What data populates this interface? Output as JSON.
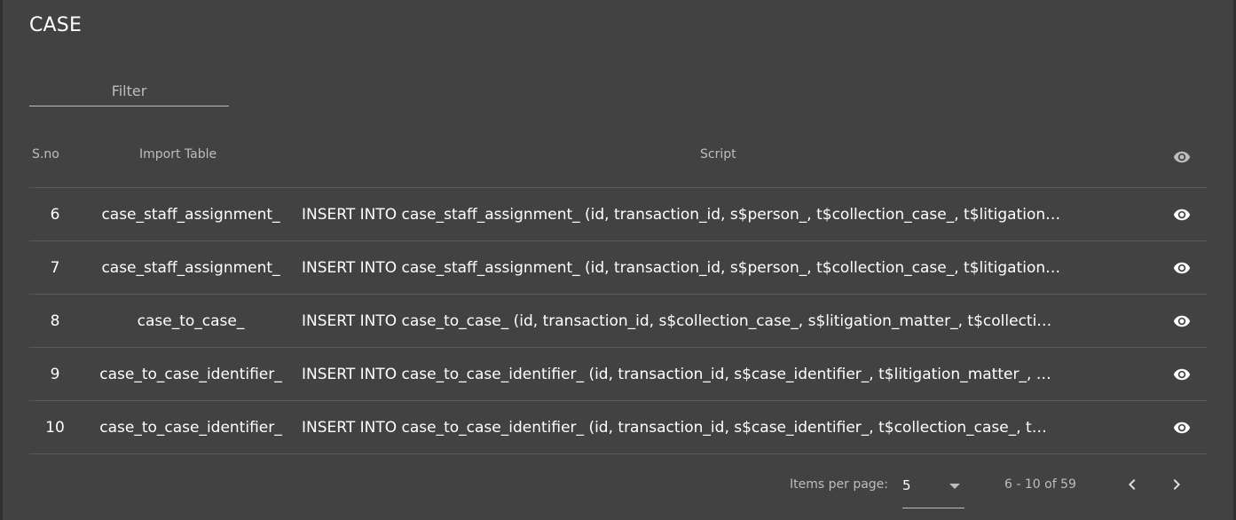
{
  "header": {
    "title": "CASE"
  },
  "filter": {
    "placeholder": "Filter"
  },
  "table": {
    "columns": {
      "sno": "S.no",
      "import_table": "Import Table",
      "script": "Script",
      "view_icon": "eye-icon"
    },
    "rows": [
      {
        "sno": "6",
        "import_table": "case_staff_assignment_",
        "script": "INSERT INTO case_staff_assignment_ (id, transaction_id, s$person_, t$collection_case_, t$litigation…"
      },
      {
        "sno": "7",
        "import_table": "case_staff_assignment_",
        "script": "INSERT INTO case_staff_assignment_ (id, transaction_id, s$person_, t$collection_case_, t$litigation…"
      },
      {
        "sno": "8",
        "import_table": "case_to_case_",
        "script": "INSERT INTO case_to_case_ (id, transaction_id, s$collection_case_, s$litigation_matter_, t$collecti…"
      },
      {
        "sno": "9",
        "import_table": "case_to_case_identifier_",
        "script": "INSERT INTO case_to_case_identifier_ (id, transaction_id, s$case_identifier_, t$litigation_matter_, …"
      },
      {
        "sno": "10",
        "import_table": "case_to_case_identifier_",
        "script": "INSERT INTO case_to_case_identifier_ (id, transaction_id, s$case_identifier_, t$collection_case_, t…"
      }
    ]
  },
  "paginator": {
    "items_per_page_label": "Items per page:",
    "items_per_page_value": "5",
    "range_label": "6 - 10 of 59",
    "prev_icon": "chevron-left-icon",
    "next_icon": "chevron-right-icon"
  },
  "colors": {
    "background": "#424242",
    "text": "#ffffff",
    "muted": "#bdbdbd",
    "divider": "#5a5a5a"
  }
}
